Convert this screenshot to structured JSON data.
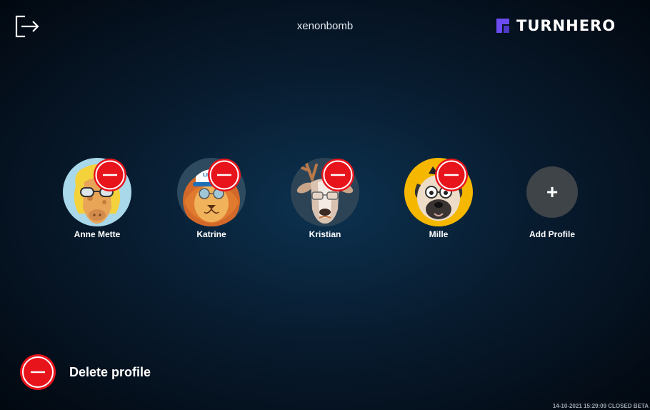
{
  "header": {
    "exit_icon": "exit-door-arrow-icon",
    "username": "xenonbomb",
    "brand_icon": "turnhero-logo-icon",
    "brand_name": "TURNHERO"
  },
  "profiles": [
    {
      "name": "Anne Mette",
      "avatar_icon": "giraffe-with-sunglasses-icon",
      "remove_icon": "remove-minus-icon"
    },
    {
      "name": "Katrine",
      "avatar_icon": "lion-with-cap-icon",
      "remove_icon": "remove-minus-icon",
      "cap_text": "LIONS"
    },
    {
      "name": "Kristian",
      "avatar_icon": "deer-with-glasses-icon",
      "remove_icon": "remove-minus-icon"
    },
    {
      "name": "Mille",
      "avatar_icon": "pug-with-glasses-icon",
      "remove_icon": "remove-minus-icon"
    }
  ],
  "add_profile": {
    "label": "Add Profile",
    "icon": "plus-icon",
    "symbol": "+"
  },
  "delete_profile": {
    "label": "Delete profile",
    "icon": "remove-minus-icon"
  },
  "footer": {
    "text": "14-10-2021 15:29:09 CLOSED BETA"
  },
  "colors": {
    "accent_red": "#e8141c",
    "brand_purple": "#6c4cf0",
    "add_circle": "#3f4448"
  }
}
